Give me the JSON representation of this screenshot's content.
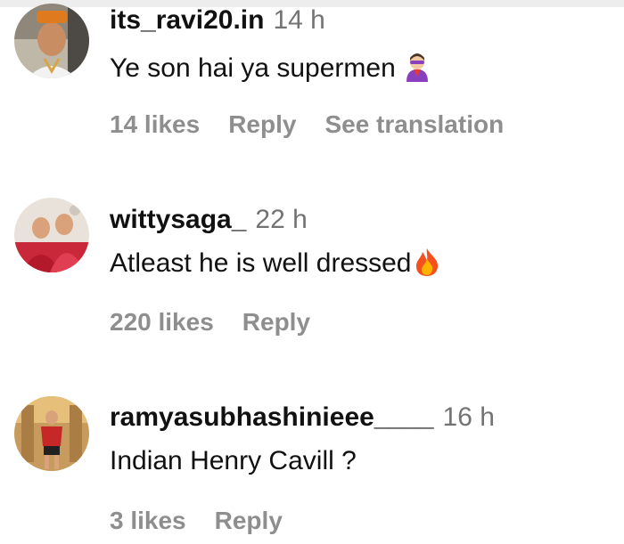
{
  "comments": [
    {
      "username": "its_ravi20.in",
      "time": "14 h",
      "text": "Ye son hai ya supermen",
      "emoji_icon": "superhero-emoji-icon",
      "likes": "14 likes",
      "reply": "Reply",
      "translation": "See translation"
    },
    {
      "username": "wittysaga_",
      "time": "22 h",
      "text": "Atleast he is well dressed",
      "emoji_icon": "fire-emoji-icon",
      "likes": "220 likes",
      "reply": "Reply"
    },
    {
      "username": "ramyasubhashinieee____",
      "time": "16 h",
      "text": "Indian Henry Cavill ?",
      "likes": "3 likes",
      "reply": "Reply"
    }
  ],
  "colors": {
    "text": "#111111",
    "muted": "#8e8e8e",
    "timestamp": "#737373",
    "background": "#ffffff"
  }
}
